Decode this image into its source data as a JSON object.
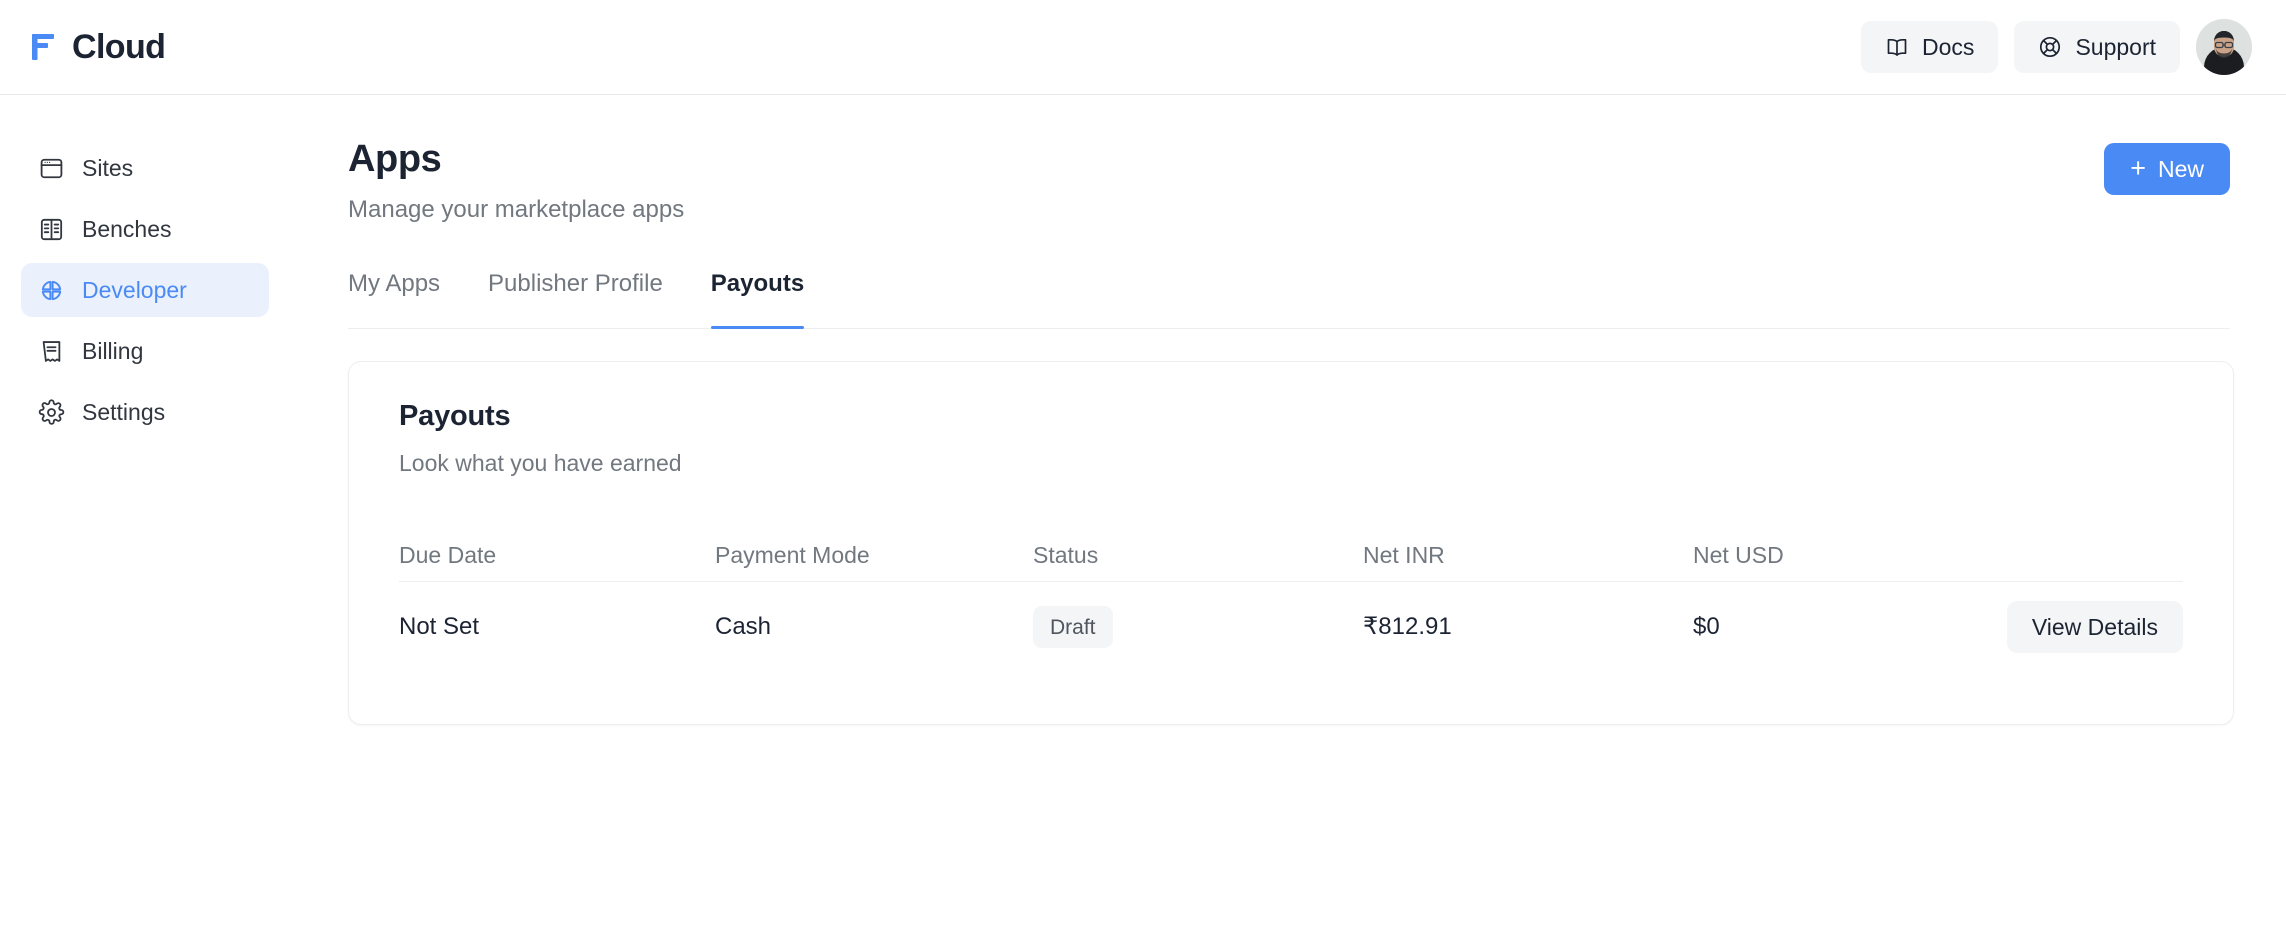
{
  "brand": {
    "name": "Cloud",
    "logo_icon": "frappe-f-logo-icon",
    "logo_color": "#4a8af4"
  },
  "header": {
    "docs_label": "Docs",
    "docs_icon": "book-open-icon",
    "support_label": "Support",
    "support_icon": "life-buoy-icon",
    "avatar_icon": "user-avatar"
  },
  "sidebar": {
    "items": [
      {
        "label": "Sites",
        "icon": "browser-window-icon",
        "active": false
      },
      {
        "label": "Benches",
        "icon": "server-panels-icon",
        "active": false
      },
      {
        "label": "Developer",
        "icon": "quadrant-circle-icon",
        "active": true
      },
      {
        "label": "Billing",
        "icon": "receipt-icon",
        "active": false
      },
      {
        "label": "Settings",
        "icon": "gear-icon",
        "active": false
      }
    ],
    "active_color": "#4a8af4",
    "active_bg": "#eaf1fd"
  },
  "page": {
    "title": "Apps",
    "subtitle": "Manage your marketplace apps",
    "new_button_label": "New",
    "new_button_icon": "plus-icon",
    "new_button_color": "#4a8af4"
  },
  "tabs": [
    {
      "label": "My Apps",
      "active": false
    },
    {
      "label": "Publisher Profile",
      "active": false
    },
    {
      "label": "Payouts",
      "active": true
    }
  ],
  "card": {
    "title": "Payouts",
    "subtitle": "Look what you have earned",
    "table": {
      "columns": [
        "Due Date",
        "Payment Mode",
        "Status",
        "Net INR",
        "Net USD"
      ],
      "rows": [
        {
          "due_date": "Not Set",
          "payment_mode": "Cash",
          "status": "Draft",
          "net_inr": "₹812.91",
          "net_usd": "$0",
          "action_label": "View Details"
        }
      ]
    }
  }
}
